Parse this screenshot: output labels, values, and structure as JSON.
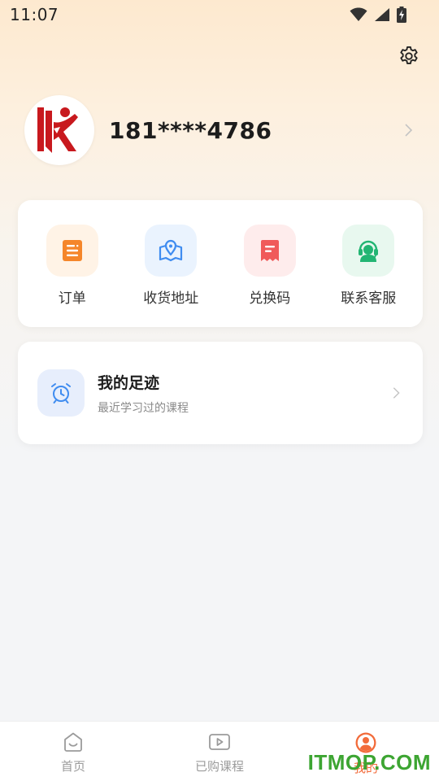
{
  "status_bar": {
    "time": "11:07"
  },
  "profile": {
    "phone": "181****4786"
  },
  "quick_actions": [
    {
      "label": "订单",
      "icon": "order-icon",
      "color": "#f5862a",
      "bg": "#fff3e6"
    },
    {
      "label": "收货地址",
      "icon": "map-pin-icon",
      "color": "#3f8cf0",
      "bg": "#eaf3fe"
    },
    {
      "label": "兑换码",
      "icon": "coupon-icon",
      "color": "#f05a5a",
      "bg": "#feecec"
    },
    {
      "label": "联系客服",
      "icon": "headset-icon",
      "color": "#22b573",
      "bg": "#e8f8ef"
    }
  ],
  "history": {
    "title": "我的足迹",
    "subtitle": "最近学习过的课程",
    "icon": "alarm-clock-icon"
  },
  "tabs": [
    {
      "label": "首页",
      "icon": "home-icon"
    },
    {
      "label": "已购课程",
      "icon": "video-icon"
    },
    {
      "label": "我的",
      "icon": "user-icon"
    }
  ],
  "watermark": "ITMOP.COM",
  "colors": {
    "accent": "#f26b3a",
    "inactive": "#9b9b9b"
  }
}
